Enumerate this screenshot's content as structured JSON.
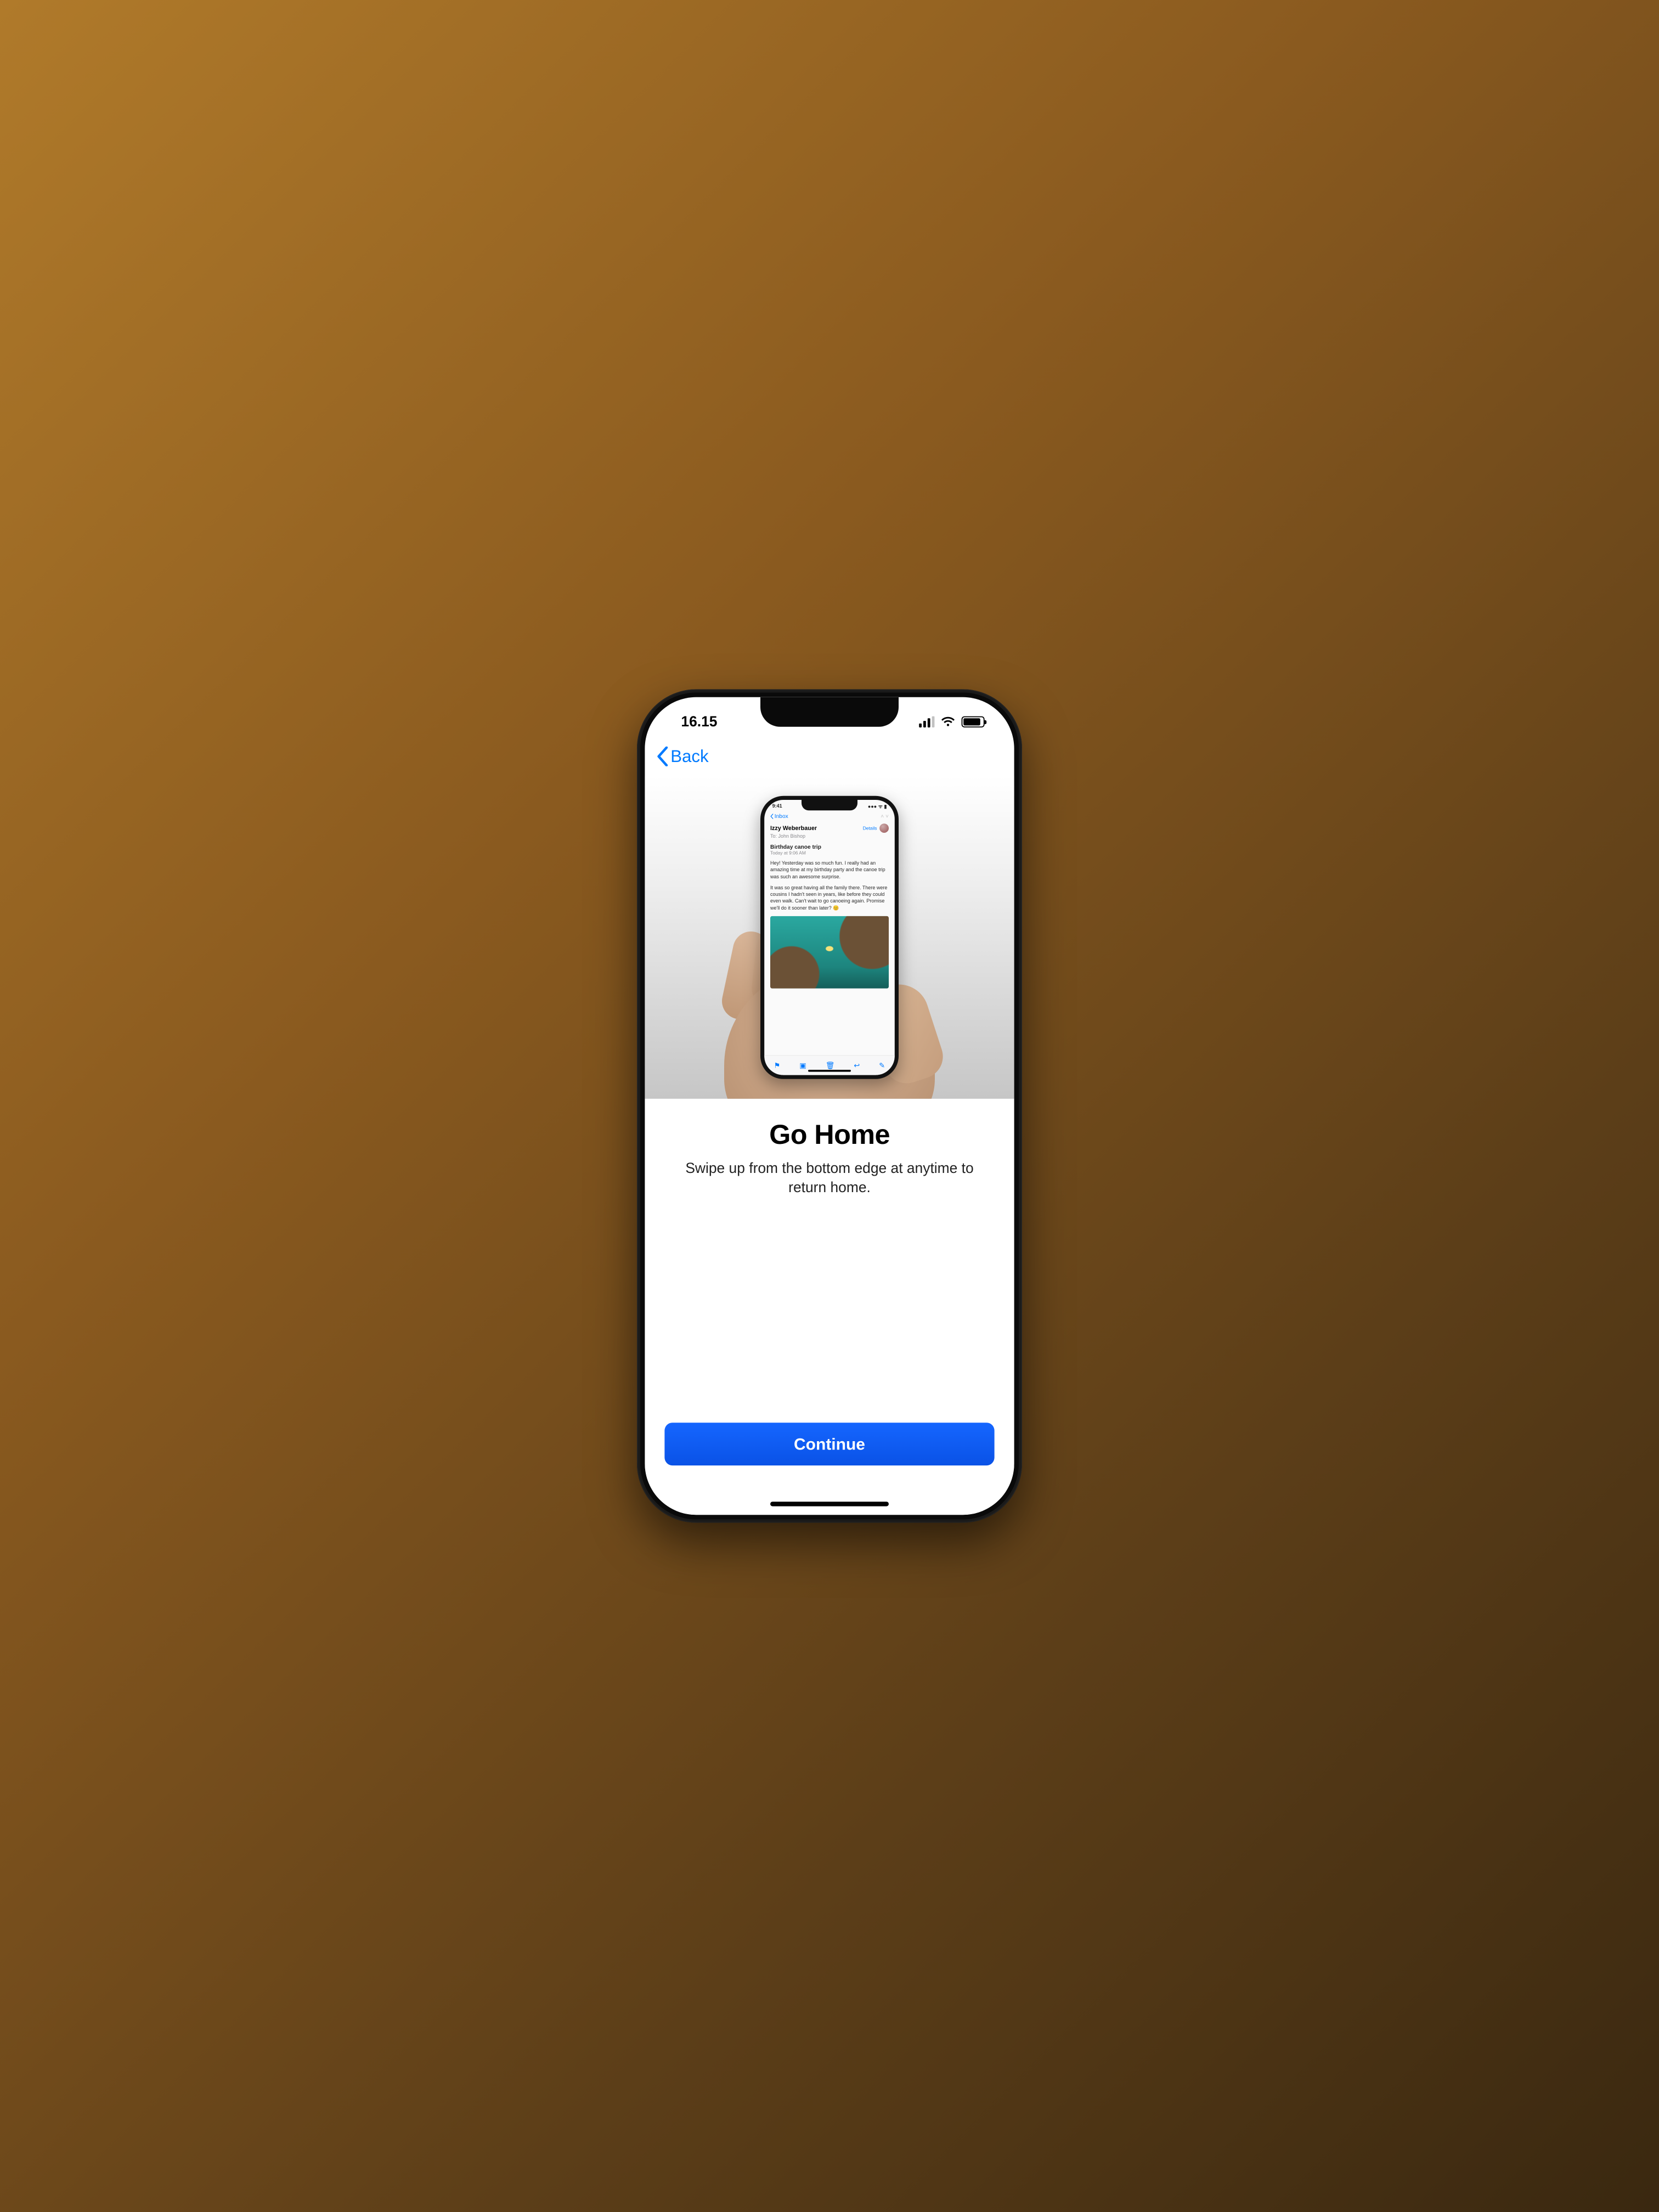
{
  "status": {
    "time": "16.15"
  },
  "nav": {
    "back_label": "Back"
  },
  "illustration": {
    "status_time": "9:41",
    "inbox_label": "Inbox",
    "from_name": "Izzy Weberbauer",
    "details_label": "Details",
    "to_line": "To: John Bishop",
    "subject": "Birthday canoe trip",
    "date_line": "Today at 9:06 AM",
    "body_p1": "Hey! Yesterday was so much fun. I really had an amazing time at my birthday party and the canoe trip was such an awesome surprise.",
    "body_p2": "It was so great having all the family there. There were cousins I hadn't seen in years, like before they could even walk. Can't wait to go canoeing again. Promise we'll do it sooner than later? 😊"
  },
  "main": {
    "title": "Go Home",
    "subtitle": "Swipe up from the bottom edge at anytime to return home."
  },
  "footer": {
    "continue_label": "Continue"
  }
}
